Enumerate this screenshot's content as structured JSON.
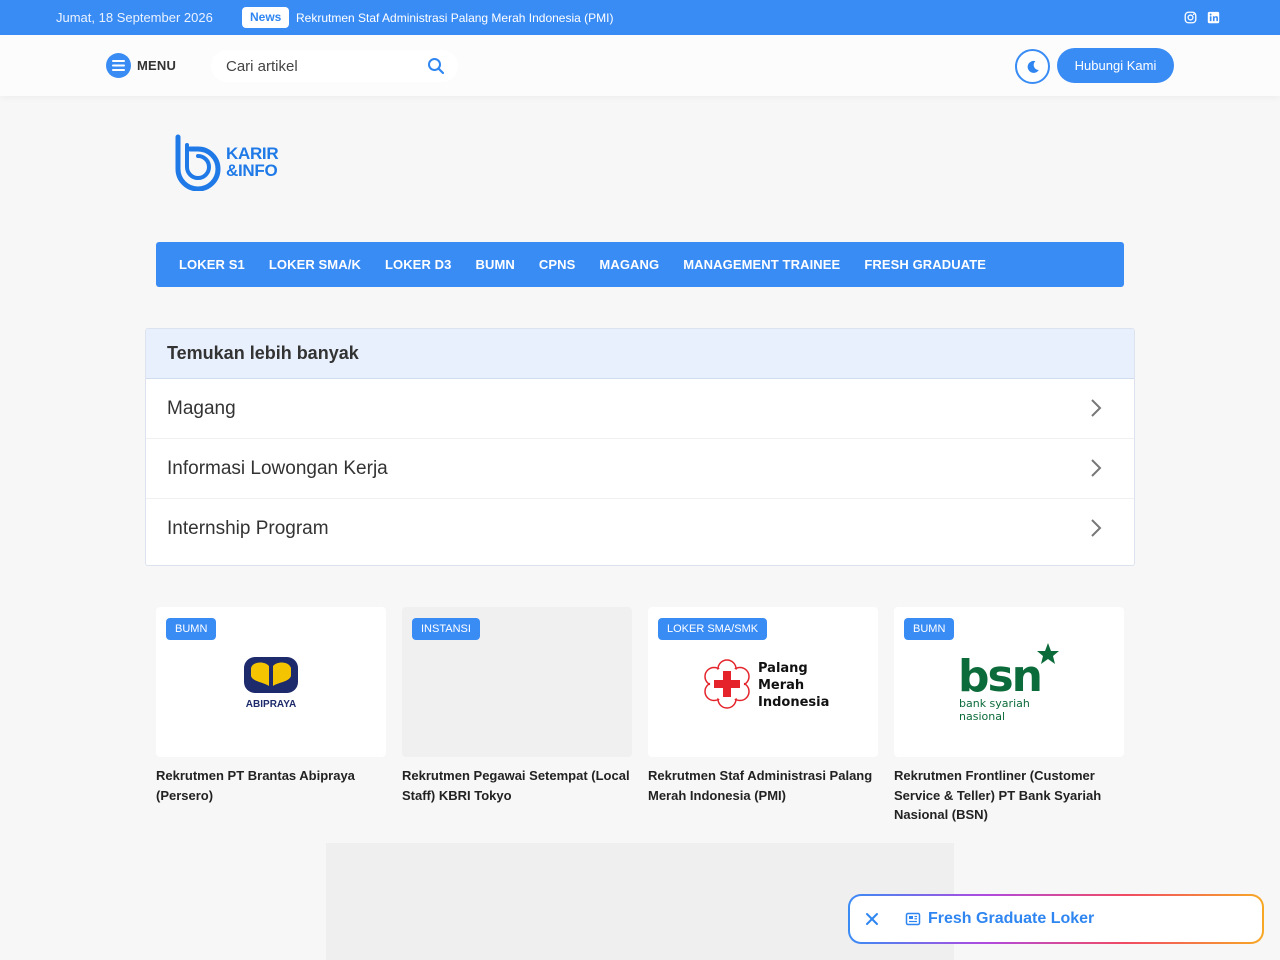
{
  "topbar": {
    "date": "Jumat, 18 September 2026",
    "news_badge": "News",
    "news_title": "Rekrutmen Staf Administrasi Palang Merah Indonesia (PMI)",
    "social_icons": [
      "instagram-icon",
      "linkedin-icon"
    ]
  },
  "header": {
    "menu_label": "MENU",
    "search_placeholder": "Cari artikel",
    "contact_label": "Hubungi Kami"
  },
  "logo": {
    "line1": "KARIR",
    "line2": "&INFO"
  },
  "nav": {
    "items": [
      "LOKER S1",
      "LOKER SMA/K",
      "LOKER D3",
      "BUMN",
      "CPNS",
      "MAGANG",
      "MANAGEMENT TRAINEE",
      "FRESH GRADUATE"
    ]
  },
  "discover": {
    "title": "Temukan lebih banyak",
    "items": [
      "Magang",
      "Informasi Lowongan Kerja",
      "Internship Program"
    ]
  },
  "cards": [
    {
      "badge": "BUMN",
      "title": "Rekrutmen PT Brantas Abipraya (Persero)",
      "logo_text": "ABIPRAYA"
    },
    {
      "badge": "INSTANSI",
      "title": "Rekrutmen Pegawai Setempat (Local Staff) KBRI Tokyo"
    },
    {
      "badge": "LOKER SMA/SMK",
      "title": "Rekrutmen Staf Administrasi Palang Merah Indonesia (PMI)",
      "logo_lines": [
        "Palang",
        "Merah",
        "Indonesia"
      ]
    },
    {
      "badge": "BUMN",
      "title": "Rekrutmen Frontliner (Customer Service & Teller) PT Bank Syariah Nasional (BSN)",
      "logo_text": "bsn",
      "logo_sub": [
        "bank syariah",
        "nasional"
      ]
    }
  ],
  "floating": {
    "label": "Fresh Graduate Loker"
  },
  "colors": {
    "primary": "#3a8cf5",
    "background": "#f7f7f7",
    "pmi_red": "#e4232b",
    "bsn_green": "#0c6b3a",
    "abipraya_navy": "#1d2a6b",
    "abipraya_yellow": "#f4c400"
  }
}
